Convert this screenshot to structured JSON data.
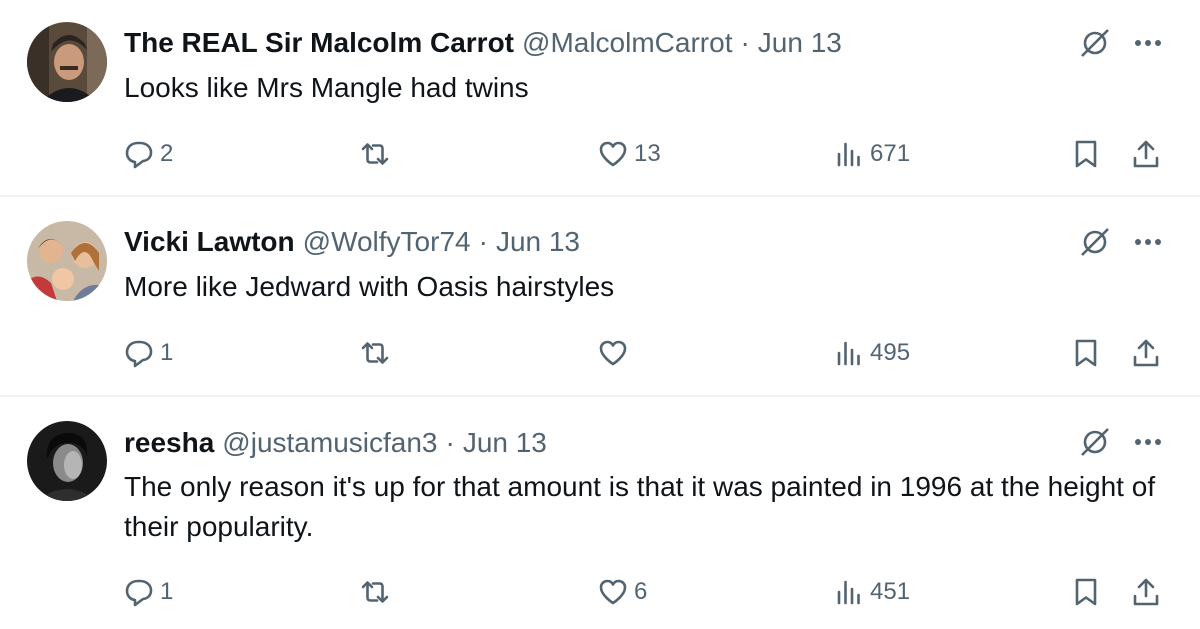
{
  "tweets": [
    {
      "name": "The REAL Sir Malcolm Carrot",
      "handle": "@MalcolmCarrot",
      "separator": "·",
      "time": "Jun 13",
      "text": "Looks like Mrs Mangle had twins",
      "replies": "2",
      "reposts": "",
      "likes": "13",
      "views": "671"
    },
    {
      "name": "Vicki Lawton",
      "handle": "@WolfyTor74",
      "separator": "·",
      "time": "Jun 13",
      "text": "More like Jedward with Oasis hairstyles",
      "replies": "1",
      "reposts": "",
      "likes": "",
      "views": "495"
    },
    {
      "name": "reesha",
      "handle": "@justamusicfan3",
      "separator": "·",
      "time": "Jun 13",
      "text": "The only reason it's up for that amount is that it was painted in 1996 at the height of their popularity.",
      "replies": "1",
      "reposts": "",
      "likes": "6",
      "views": "451"
    }
  ],
  "icons": {
    "reply": "reply-icon",
    "repost": "repost-icon",
    "like": "heart-icon",
    "views": "views-icon",
    "bookmark": "bookmark-icon",
    "share": "share-icon",
    "grok": "grok-icon",
    "more": "more-icon"
  },
  "colors": {
    "text": "#0f1419",
    "secondary": "#536471",
    "divider": "#eff3f4"
  }
}
